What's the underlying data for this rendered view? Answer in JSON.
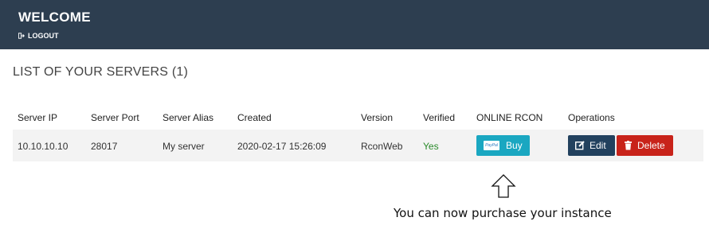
{
  "header": {
    "title": "WELCOME",
    "logout_label": "LOGOUT",
    "logout_icon": "sign-out-icon"
  },
  "page": {
    "title": "LIST OF YOUR SERVERS (1)"
  },
  "table": {
    "columns": [
      "Server IP",
      "Server Port",
      "Server Alias",
      "Created",
      "Version",
      "Verified",
      "ONLINE RCON",
      "Operations"
    ],
    "rows": [
      {
        "ip": "10.10.10.10",
        "port": "28017",
        "alias": "My server",
        "created": "2020-02-17 15:26:09",
        "version": "RconWeb",
        "verified": "Yes",
        "buy_label": "Buy",
        "paypal_label": "PayPal",
        "edit_label": "Edit",
        "delete_label": "Delete"
      }
    ]
  },
  "annotation": {
    "text": "You can now purchase your instance",
    "icon": "up-arrow-icon"
  },
  "colors": {
    "header_bg": "#2d3e50",
    "buy_button": "#1aa7c1",
    "edit_button": "#22415e",
    "delete_button": "#c8231a",
    "verified_text": "#2a8a2a"
  }
}
